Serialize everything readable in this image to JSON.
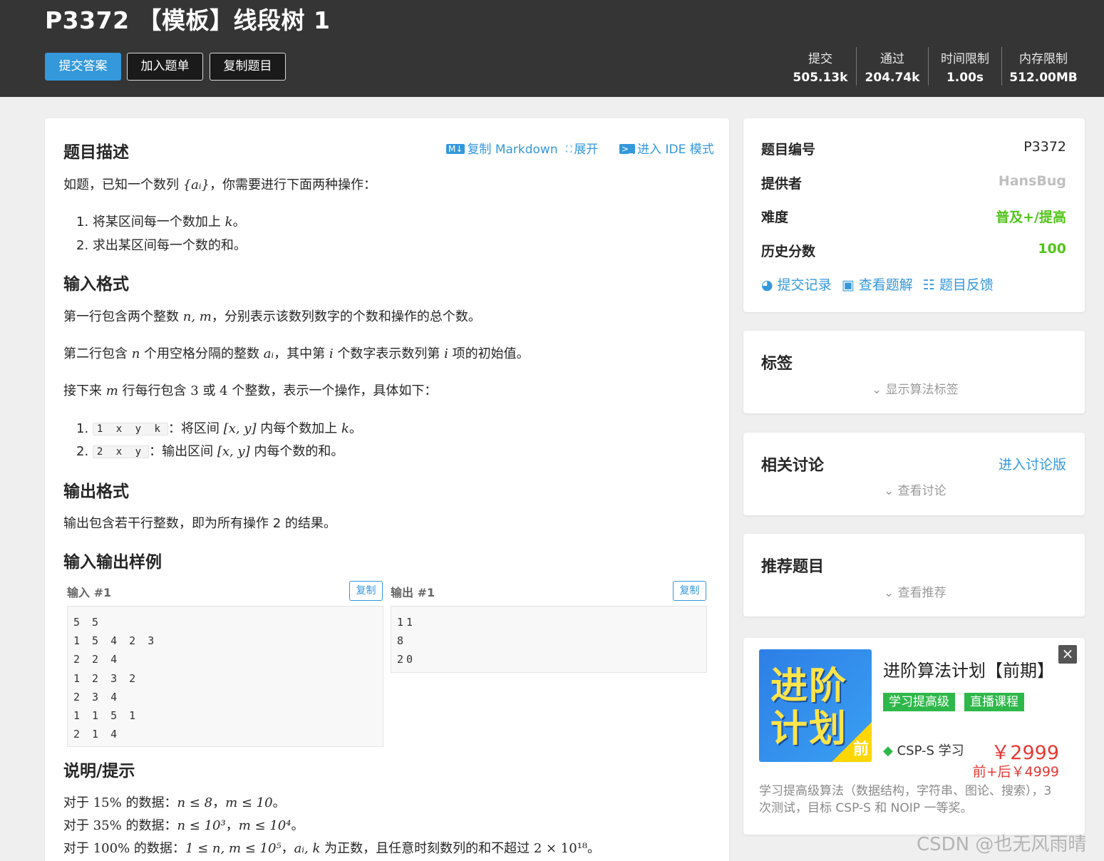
{
  "header": {
    "title": "P3372 【模板】线段树 1",
    "buttons": {
      "submit": "提交答案",
      "add_to_list": "加入题单",
      "copy_problem": "复制题目"
    },
    "stats": [
      {
        "label": "提交",
        "value": "505.13k"
      },
      {
        "label": "通过",
        "value": "204.74k"
      },
      {
        "label": "时间限制",
        "value": "1.00s"
      },
      {
        "label": "内存限制",
        "value": "512.00MB"
      }
    ]
  },
  "toolbar": {
    "copy_markdown": "复制 Markdown",
    "expand": "展开",
    "ide_mode": "进入 IDE 模式"
  },
  "description": {
    "heading": "题目描述",
    "intro_pre": "如题，已知一个数列 ",
    "intro_math": "{aᵢ}",
    "intro_post": "，你需要进行下面两种操作：",
    "ops": [
      {
        "num": "1.",
        "pre": "将某区间每一个数加上 ",
        "math": "k",
        "post": "。"
      },
      {
        "num": "2.",
        "pre": "求出某区间每一个数的和。",
        "math": "",
        "post": ""
      }
    ]
  },
  "input_format": {
    "heading": "输入格式",
    "line1_pre": "第一行包含两个整数 ",
    "line1_math": "n, m",
    "line1_post": "，分别表示该数列数字的个数和操作的总个数。",
    "line2_a": "第二行包含 ",
    "line2_m1": "n",
    "line2_b": " 个用空格分隔的整数 ",
    "line2_m2": "aᵢ",
    "line2_c": "，其中第 ",
    "line2_m3": "i",
    "line2_d": " 个数字表示数列第 ",
    "line2_m4": "i",
    "line2_e": " 项的初始值。",
    "line3_a": "接下来 ",
    "line3_m1": "m",
    "line3_b": " 行每行包含 ",
    "line3_m2": "3",
    "line3_c": " 或 ",
    "line3_m3": "4",
    "line3_d": " 个整数，表示一个操作，具体如下：",
    "ops": [
      {
        "num": "1.",
        "code": "1 x y k",
        "pre": "：将区间 ",
        "math": "[x, y]",
        "post": " 内每个数加上 ",
        "math2": "k",
        "end": "。"
      },
      {
        "num": "2.",
        "code": "2 x y",
        "pre": "：输出区间 ",
        "math": "[x, y]",
        "post": " 内每个数的和。",
        "math2": "",
        "end": ""
      }
    ]
  },
  "output_format": {
    "heading": "输出格式",
    "text": "输出包含若干行整数，即为所有操作 2 的结果。"
  },
  "samples": {
    "heading": "输入输出样例",
    "input_label": "输入 #1",
    "output_label": "输出 #1",
    "copy_label": "复制",
    "input_lines": [
      "5 5",
      "1 5 4 2 3",
      "2 2 4",
      "1 2 3 2",
      "2 3 4",
      "1 1 5 1",
      "2 1 4"
    ],
    "output_lines": [
      "11",
      "8",
      "20"
    ]
  },
  "hint": {
    "heading": "说明/提示",
    "l1_a": "对于 ",
    "l1_m1": "15%",
    "l1_b": " 的数据：",
    "l1_m2": "n ≤ 8",
    "l1_c": "，",
    "l1_m3": "m ≤ 10",
    "l1_d": "。",
    "l2_a": "对于 ",
    "l2_m1": "35%",
    "l2_b": " 的数据：",
    "l2_m2": "n ≤ 10³",
    "l2_c": "，",
    "l2_m3": "m ≤ 10⁴",
    "l2_d": "。",
    "l3_a": "对于 ",
    "l3_m1": "100%",
    "l3_b": " 的数据：",
    "l3_m2": "1 ≤ n, m ≤ 10⁵",
    "l3_c": "，",
    "l3_m3": "aᵢ, k",
    "l3_d": " 为正数，且任意时刻数列的和不超过 ",
    "l3_m4": "2 × 10¹⁸",
    "l3_e": "。"
  },
  "info": {
    "rows": [
      {
        "key": "题目编号",
        "value": "P3372",
        "color": "#262626"
      },
      {
        "key": "提供者",
        "value": "HansBug",
        "color": "#bfbfbf"
      },
      {
        "key": "难度",
        "value": "普及+/提高",
        "color": "#52c41a"
      },
      {
        "key": "历史分数",
        "value": "100",
        "color": "#52c41a"
      }
    ],
    "links": {
      "records": "提交记录",
      "solutions": "查看题解",
      "feedback": "题目反馈"
    }
  },
  "tags": {
    "title": "标签",
    "toggle": "显示算法标签"
  },
  "discuss": {
    "title": "相关讨论",
    "link": "进入讨论版",
    "toggle": "查看讨论"
  },
  "recommend": {
    "title": "推荐题目",
    "toggle": "查看推荐"
  },
  "ad": {
    "image_text_1": "进阶",
    "image_text_2": "计划",
    "image_corner": "前",
    "title": "进阶算法计划【前期】",
    "tags": [
      "学习提高级",
      "直播课程"
    ],
    "csp": "CSP-S 学习",
    "price": "￥2999",
    "price2": "前+后￥4999",
    "desc": "学习提高级算法（数据结构，字符串、图论、搜索），3 次测试，目标 CSP-S 和 NOIP 一等奖。",
    "close": "×"
  },
  "watermark": "CSDN @也无风雨晴",
  "colors": {
    "accent": "#3498db",
    "header_bg": "#353535",
    "green": "#52c41a",
    "price_red": "#e53935"
  }
}
